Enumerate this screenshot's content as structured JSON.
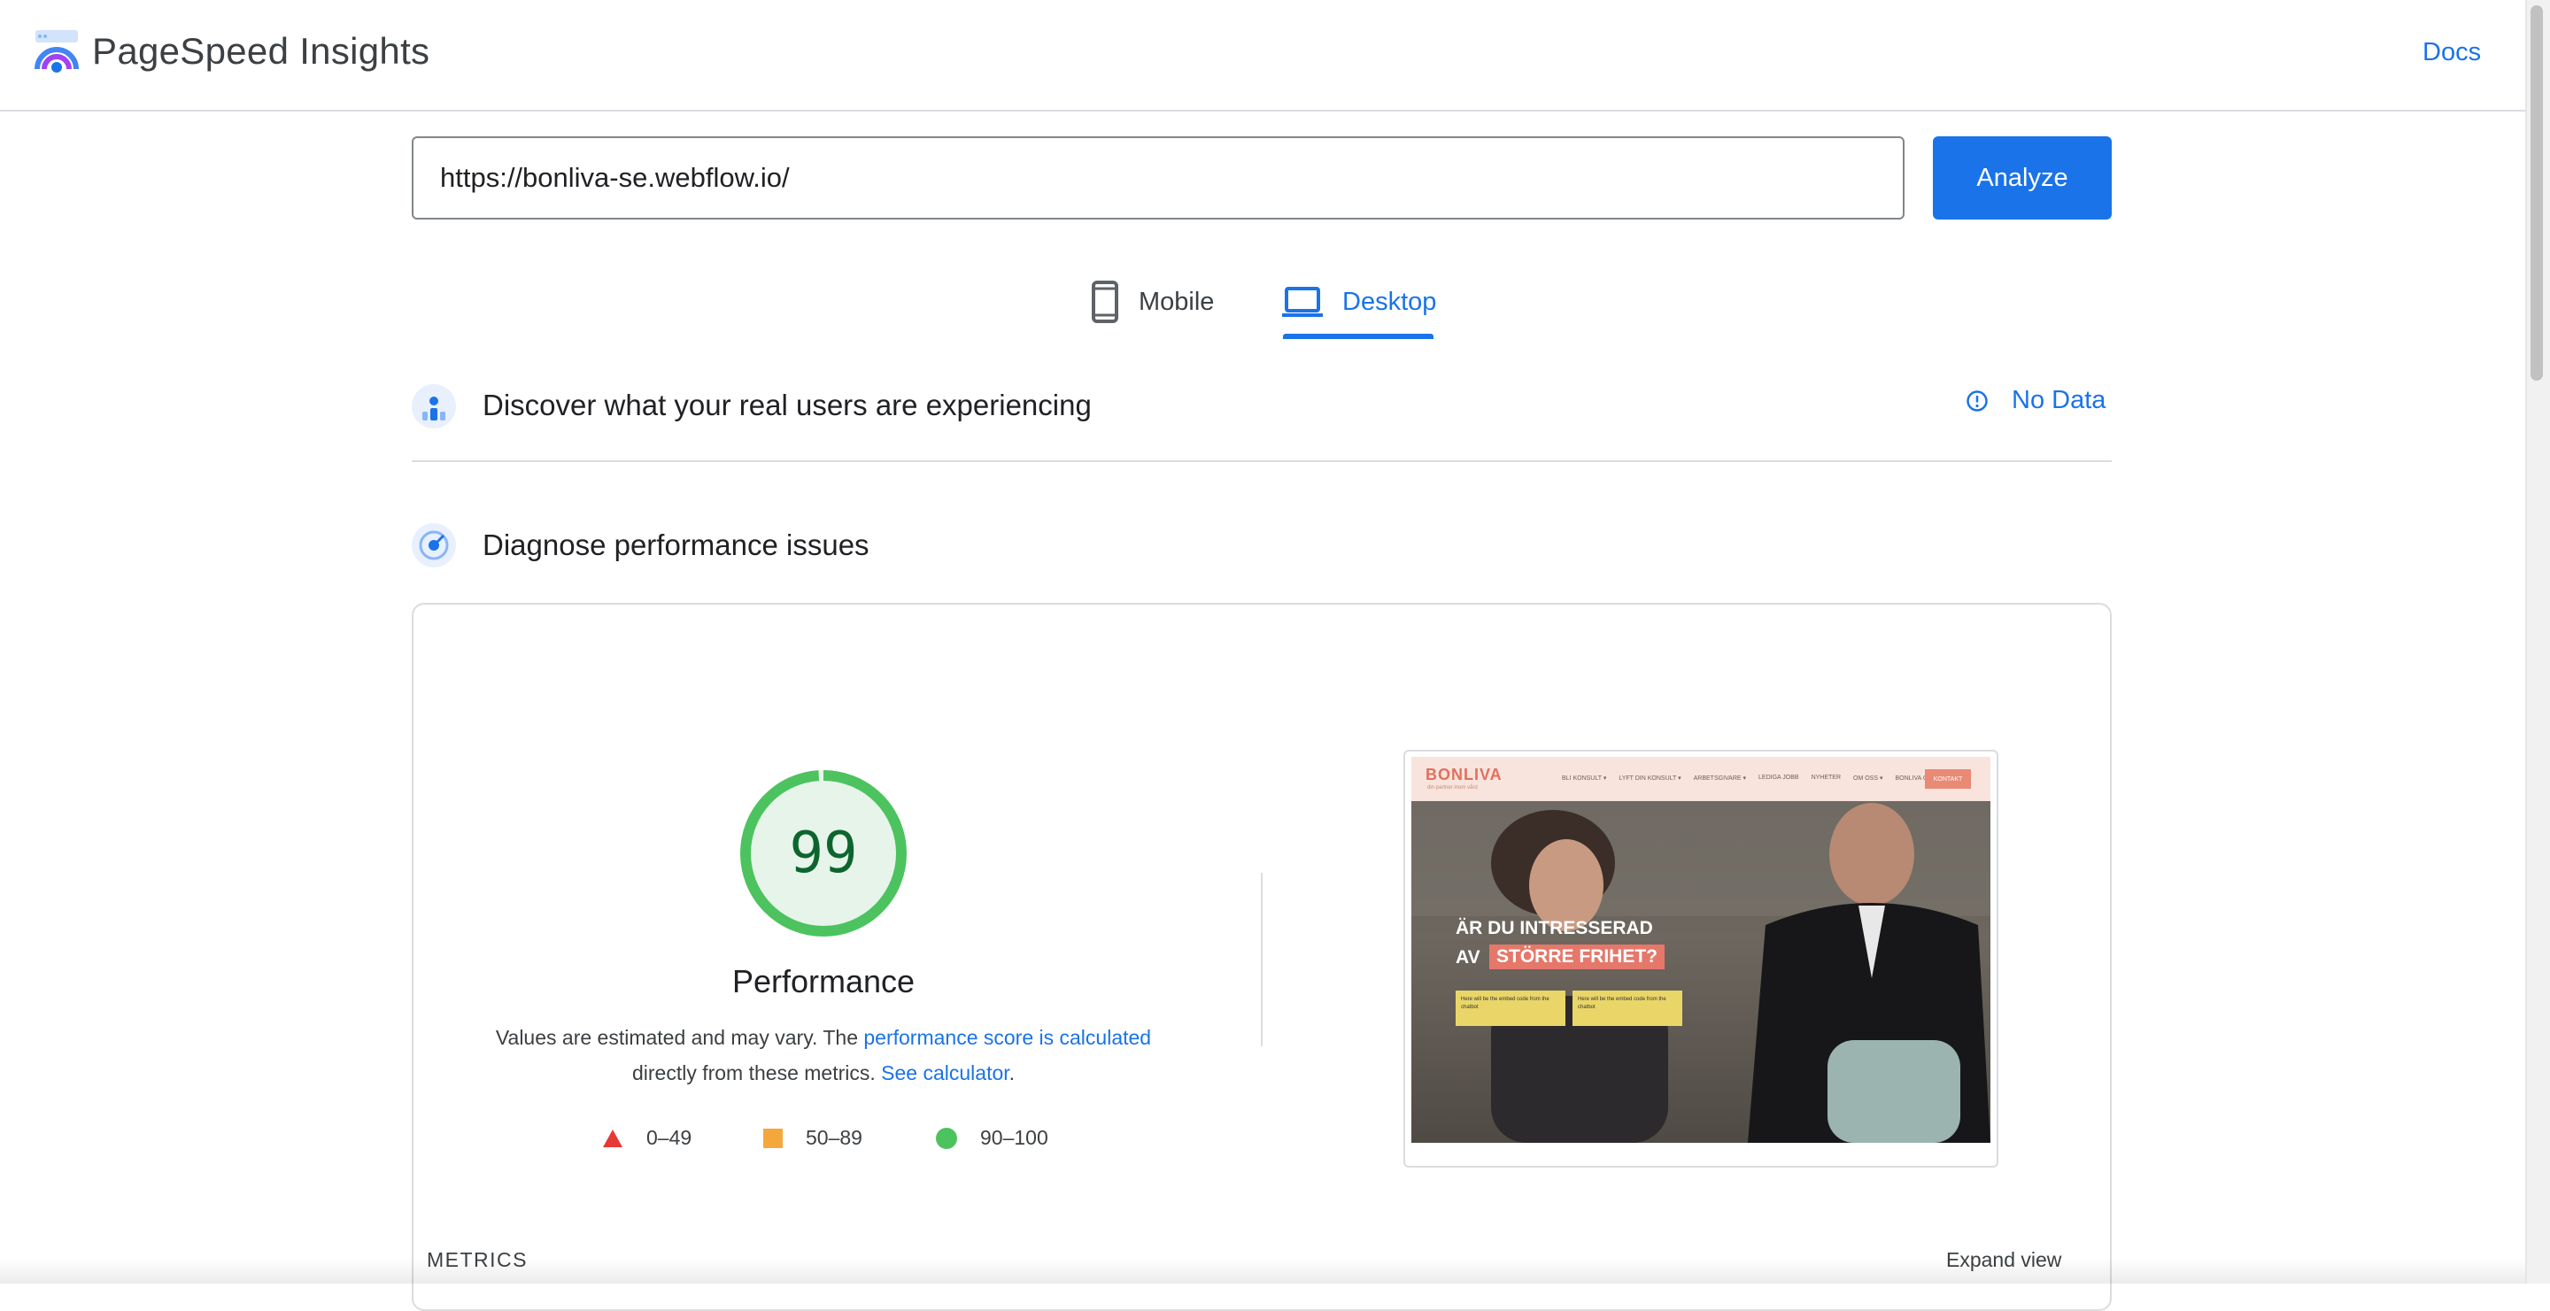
{
  "header": {
    "title": "PageSpeed Insights",
    "docs_label": "Docs"
  },
  "url_bar": {
    "value": "https://bonliva-se.webflow.io/",
    "analyze_label": "Analyze"
  },
  "tabs": [
    {
      "label": "Mobile",
      "icon": "mobile-phone-icon",
      "selected": false
    },
    {
      "label": "Desktop",
      "icon": "laptop-icon",
      "selected": true
    }
  ],
  "field_data": {
    "title": "Discover what your real users are experiencing",
    "status": "No Data",
    "icon": "people-chart-icon"
  },
  "lab_data": {
    "title": "Diagnose performance issues",
    "icon": "target-icon",
    "score": "99",
    "score_fraction": 0.99,
    "category": "Performance",
    "desc_part1": "Values are estimated and may vary. The ",
    "desc_link1": "performance score is calculated",
    "desc_part2": "directly from these metrics. ",
    "desc_link2": "See calculator",
    "desc_end": ".",
    "legend": [
      {
        "range": "0–49",
        "shape": "triangle",
        "color": "#e53935"
      },
      {
        "range": "50–89",
        "shape": "square",
        "color": "#f4a83c"
      },
      {
        "range": "90–100",
        "shape": "circle",
        "color": "#4cc35e"
      }
    ],
    "metrics_label": "METRICS",
    "expand_label": "Expand view"
  },
  "screenshot": {
    "logo": "BONLIVA",
    "logo_sub": "din partner inom vård",
    "menu": [
      "BLI KONSULT ▾",
      "LYFT DIN KONSULT ▾",
      "ARBETSGIVARE ▾",
      "LEDIGA JOBB",
      "NYHETER",
      "OM OSS ▾",
      "BONLIVA CARE ▾"
    ],
    "cta": "KONTAKT",
    "headline1": "ÄR DU INTRESSERAD",
    "headline2a": "AV",
    "headline2b": "STÖRRE FRIHET?",
    "box1": "Here will be the embed code from the chatbot",
    "box2": "Here will be the embed code from the chatbot"
  },
  "colors": {
    "accent": "#1a73e8",
    "pass": "#0cce6b",
    "score_text": "#0d652d"
  }
}
